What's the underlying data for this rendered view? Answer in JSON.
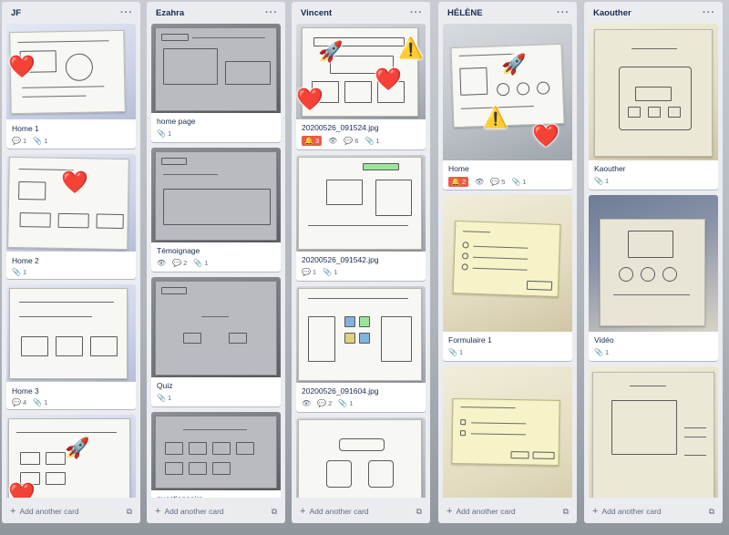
{
  "board": {
    "add_card_label": "Add another card",
    "lists": [
      {
        "name": "JF",
        "cards": [
          {
            "title": "Home 1",
            "comments": "1",
            "attachments": "1"
          },
          {
            "title": "Home 2",
            "attachments": "1"
          },
          {
            "title": "Home 3",
            "comments": "4",
            "attachments": "1"
          },
          {
            "title": ""
          }
        ]
      },
      {
        "name": "Ezahra",
        "cards": [
          {
            "title": "home page",
            "attachments": "1"
          },
          {
            "title": "Témoignage",
            "comments": "2",
            "attachments": "1"
          },
          {
            "title": "Quiz",
            "attachments": "1"
          },
          {
            "title": "questionnaire"
          }
        ]
      },
      {
        "name": "Vincent",
        "cards": [
          {
            "title": "20200526_091524.jpg",
            "alerts": "3",
            "comments": "6",
            "attachments": "1"
          },
          {
            "title": "20200526_091542.jpg",
            "comments": "1",
            "attachments": "1"
          },
          {
            "title": "20200526_091604.jpg",
            "comments": "2",
            "attachments": "1"
          },
          {
            "title": ""
          }
        ]
      },
      {
        "name": "HÉLÈNE",
        "cards": [
          {
            "title": "Home",
            "alerts": "2",
            "comments": "5",
            "attachments": "1"
          },
          {
            "title": "Formulaire 1",
            "attachments": "1"
          },
          {
            "title": ""
          }
        ]
      },
      {
        "name": "Kaouther",
        "cards": [
          {
            "title": "Kaouther",
            "attachments": "1"
          },
          {
            "title": "Vidéo",
            "attachments": "1"
          },
          {
            "title": ""
          }
        ]
      }
    ]
  },
  "icons": {
    "menu": "···",
    "plus": "+",
    "template": "⧉",
    "comment": "💬",
    "attachment": "📎",
    "eye": "👁",
    "alert": "🔔",
    "heart": "❤️",
    "rocket": "🚀",
    "warning": "⚠️"
  },
  "colors": {
    "list_bg": "#ebecf0",
    "card_bg": "#ffffff",
    "alert_badge": "#eb5a46",
    "text": "#172b4d",
    "muted": "#5e6c84"
  }
}
